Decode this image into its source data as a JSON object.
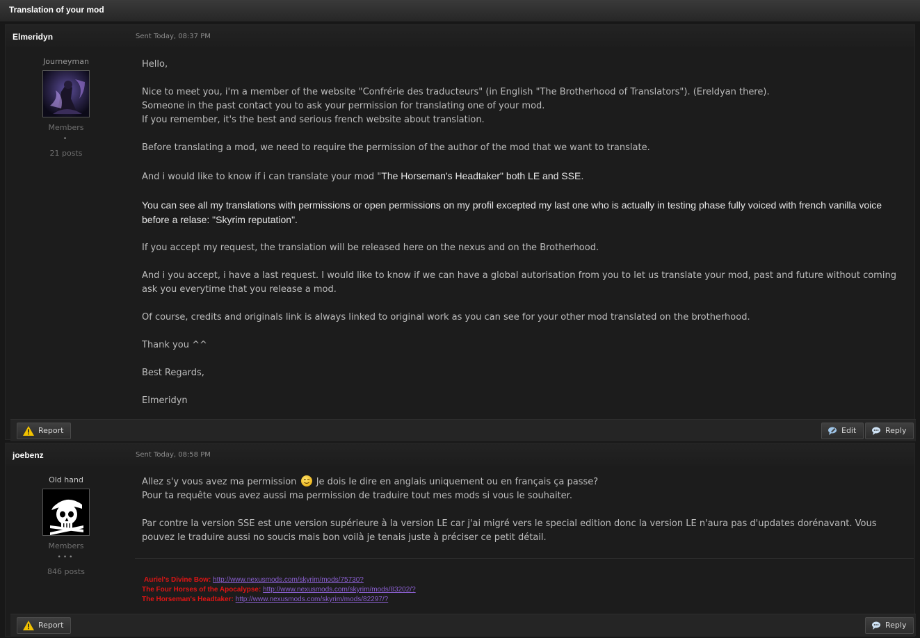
{
  "page_title": "Translation of your mod",
  "posts": [
    {
      "author": "Elmeridyn",
      "date": "Sent Today, 08:37 PM",
      "rank": "Journeyman",
      "group": "Members",
      "pips": "•",
      "posts": "21 posts",
      "body": [
        "Hello,",
        "Nice to meet you, i'm a member of the website \"Confrérie des traducteurs\" (in English \"The Brotherhood of Translators\"). (Ereldyan there).",
        "Someone in the past contact you to ask your permission for translating one of your mod.",
        "If you remember, it's the best and serious french website about translation.",
        "Before translating a mod, we need to require the permission of the author of the mod that we want to translate.",
        "And i would like to know if i can translate your mod \"",
        "The Horseman's Headtaker\" both LE and SSE",
        ".",
        "You can see all my translations with permissions or open permissions on my profil excepted my last one who is actually in testing phase fully voiced with french vanilla voice before a relase: \"Skyrim reputation\".",
        "If you accept my request, the translation will be released here on the nexus and on the Brotherhood.",
        "And i you accept, i have a last request. I would like to know if we can have a global autorisation from you to let us translate your mod, past and future without coming ask you everytime that you release a mod.",
        "Of course, credits and originals link is always linked to original work as you can see for your other mod translated on the brotherhood.",
        "Thank you ^^",
        "Best Regards,",
        "Elmeridyn"
      ],
      "buttons": {
        "report": "Report",
        "edit": "Edit",
        "reply": "Reply"
      }
    },
    {
      "author": "joebenz",
      "date": "Sent Today, 08:58 PM",
      "rank": "Old hand",
      "group": "Members",
      "pips": "•••",
      "posts": "846 posts",
      "body": [
        "Allez s'y vous avez ma permission",
        "Je dois le dire en anglais uniquement ou en français ça passe?",
        "Pour ta requête vous avez aussi ma permission de traduire tout mes mods si vous le souhaiter.",
        "Par contre la version SSE est une version supérieure à la version LE car j'ai migré vers le special edition donc la version LE n'aura pas d'updates dorénavant. Vous pouvez le traduire aussi no soucis mais bon voilà je tenais juste à préciser ce petit détail."
      ],
      "signature": [
        {
          "label": "Auriel's Divine Bow: ",
          "link": "http://www.nexusmods.com/skyrim/mods/75730?"
        },
        {
          "label": "The Four Horses of the Apocalypse: ",
          "link": "http://www.nexusmods.com/skyrim/mods/83202/?"
        },
        {
          "label": "The Horseman's Headtaker: ",
          "link": "http://www.nexusmods.com/skyrim/mods/82297/?"
        }
      ],
      "buttons": {
        "report": "Report",
        "reply": "Reply"
      }
    }
  ],
  "colors": {
    "accent_red": "#e01515",
    "link": "#8a5fd0"
  }
}
